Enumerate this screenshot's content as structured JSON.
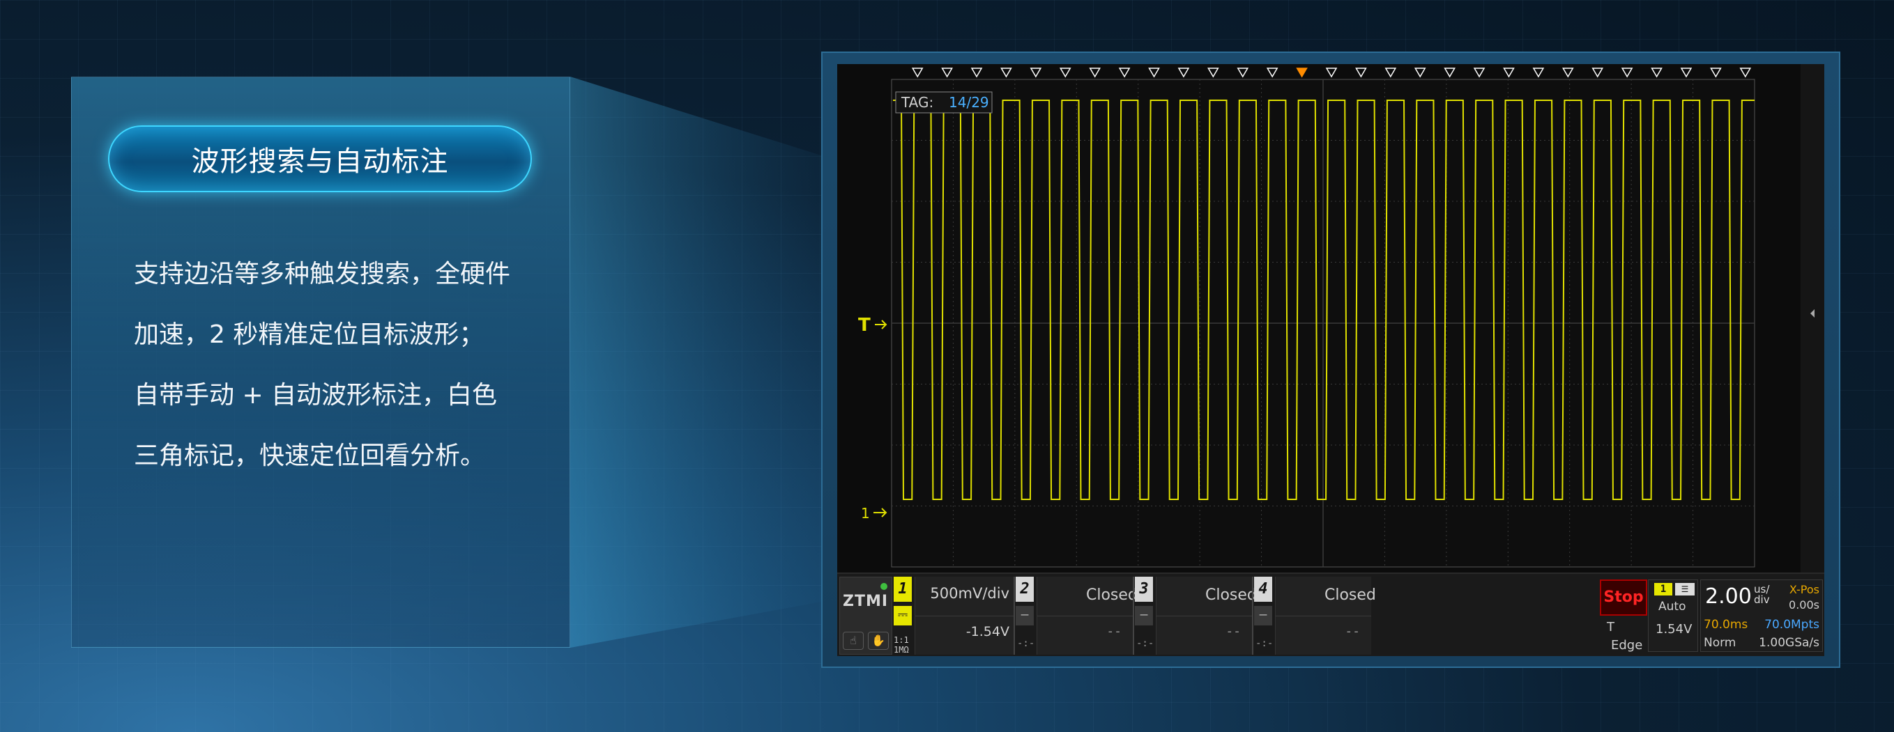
{
  "feature": {
    "title": "波形搜索与自动标注",
    "description": [
      "支持边沿等多种触发搜索，全硬件",
      "加速，2 秒精准定位目标波形；",
      "自带手动 + 自动波形标注，白色",
      "三角标记，快速定位回看分析。"
    ]
  },
  "scope": {
    "tag_label": "TAG:",
    "tag_value": "14/29",
    "trigger_marker": "T",
    "channel_marker": "1",
    "search_marks_total": 29,
    "search_mark_current": 14,
    "pulse_count": 29,
    "colors": {
      "waveform": "#e0e000",
      "mark_normal": "#ffffff",
      "mark_current": "#ff8c00",
      "tag_text": "#4ab0ff",
      "grid": "#3a3a3a"
    },
    "logo": "ZTMI",
    "channels": [
      {
        "num": "1",
        "scale": "500mV/div",
        "offset": "-1.54V",
        "impedance_line1": "1:1",
        "impedance_line2": "1MΩ",
        "active": true
      },
      {
        "num": "2",
        "status": "Closed",
        "value": "--",
        "sub": "-:-"
      },
      {
        "num": "3",
        "status": "Closed",
        "value": "--",
        "sub": "-:-"
      },
      {
        "num": "4",
        "status": "Closed",
        "value": "--",
        "sub": "-:-"
      }
    ],
    "acquisition": {
      "run_state": "Stop",
      "trigger_channel": "1",
      "trigger_mode": "Auto",
      "trigger_source_label": "T",
      "trigger_level": "1.54V",
      "trigger_type": "Edge"
    },
    "timebase": {
      "value": "2.00",
      "unit_top": "us/",
      "unit_bottom": "div",
      "xpos_label": "X-Pos",
      "xpos_value": "0.00s",
      "record_length_time": "70.0ms",
      "record_points": "70.0Mpts",
      "acq_mode": "Norm",
      "sample_rate": "1.00GSa/s"
    }
  }
}
